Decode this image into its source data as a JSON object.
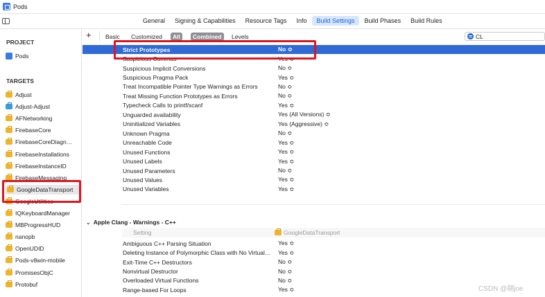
{
  "window": {
    "title": "Pods"
  },
  "tabs": [
    {
      "label": "General",
      "active": false
    },
    {
      "label": "Signing & Capabilities",
      "active": false
    },
    {
      "label": "Resource Tags",
      "active": false
    },
    {
      "label": "Info",
      "active": false
    },
    {
      "label": "Build Settings",
      "active": true
    },
    {
      "label": "Build Phases",
      "active": false
    },
    {
      "label": "Build Rules",
      "active": false
    }
  ],
  "sidebar": {
    "project_heading": "PROJECT",
    "project_item": "Pods",
    "targets_heading": "TARGETS",
    "targets": [
      "Adjust",
      "Adjust-Adjust",
      "AFNetworking",
      "FirebaseCore",
      "FirebaseCoreDiagn…",
      "FirebaseInstallations",
      "FirebaseInstanceID",
      "FirebaseMessaging",
      "GoogleDataTransport",
      "GoogleUtilities",
      "IQKeyboardManager",
      "MBProgressHUD",
      "nanopb",
      "OpenUDID",
      "Pods-v8win-mobile",
      "PromisesObjC",
      "Protobuf"
    ],
    "selected_target": "GoogleDataTransport"
  },
  "filterbar": {
    "plus": "+",
    "basic": "Basic",
    "customized": "Customized",
    "all": "All",
    "combined": "Combined",
    "levels": "Levels",
    "search_value": "CL"
  },
  "settings_rows": [
    {
      "name": "Strict Prototypes",
      "value": "No ≎",
      "highlight": true
    },
    {
      "name": "Suspicious Commas",
      "value": "Yes ≎"
    },
    {
      "name": "Suspicious Implicit Conversions",
      "value": "No ≎"
    },
    {
      "name": "Suspicious Pragma Pack",
      "value": "Yes ≎"
    },
    {
      "name": "Treat Incompatible Pointer Type Warnings as Errors",
      "value": "No ≎"
    },
    {
      "name": "Treat Missing Function Prototypes as Errors",
      "value": "No ≎"
    },
    {
      "name": "Typecheck Calls to printf/scanf",
      "value": "Yes ≎"
    },
    {
      "name": "Unguarded availability",
      "value": "Yes (All Versions) ≎"
    },
    {
      "name": "Uninitialized Variables",
      "value": "Yes (Aggressive) ≎"
    },
    {
      "name": "Unknown Pragma",
      "value": "No ≎"
    },
    {
      "name": "Unreachable Code",
      "value": "Yes ≎"
    },
    {
      "name": "Unused Functions",
      "value": "Yes ≎"
    },
    {
      "name": "Unused Labels",
      "value": "Yes ≎"
    },
    {
      "name": "Unused Parameters",
      "value": "No ≎"
    },
    {
      "name": "Unused Values",
      "value": "Yes ≎"
    },
    {
      "name": "Unused Variables",
      "value": "Yes ≎"
    }
  ],
  "cpp_section": {
    "title": "Apple Clang - Warnings - C++",
    "col_setting": "Setting",
    "col_target": "GoogleDataTransport",
    "rows": [
      {
        "name": "Ambiguous C++ Parsing Situation",
        "value": "Yes ≎"
      },
      {
        "name": "Deleting Instance of Polymorphic Class with No Virtual…",
        "value": "Yes ≎"
      },
      {
        "name": "Exit-Time C++ Destructors",
        "value": "No ≎"
      },
      {
        "name": "Nonvirtual Destructor",
        "value": "No ≎"
      },
      {
        "name": "Overloaded Virtual Functions",
        "value": "No ≎"
      },
      {
        "name": "Range-based For Loops",
        "value": "Yes ≎"
      }
    ]
  },
  "watermark": "CSDN @胡joe",
  "colors": {
    "accent": "#2f6ad6",
    "annotation": "#e0141e",
    "target_icon": "#f0b429"
  }
}
